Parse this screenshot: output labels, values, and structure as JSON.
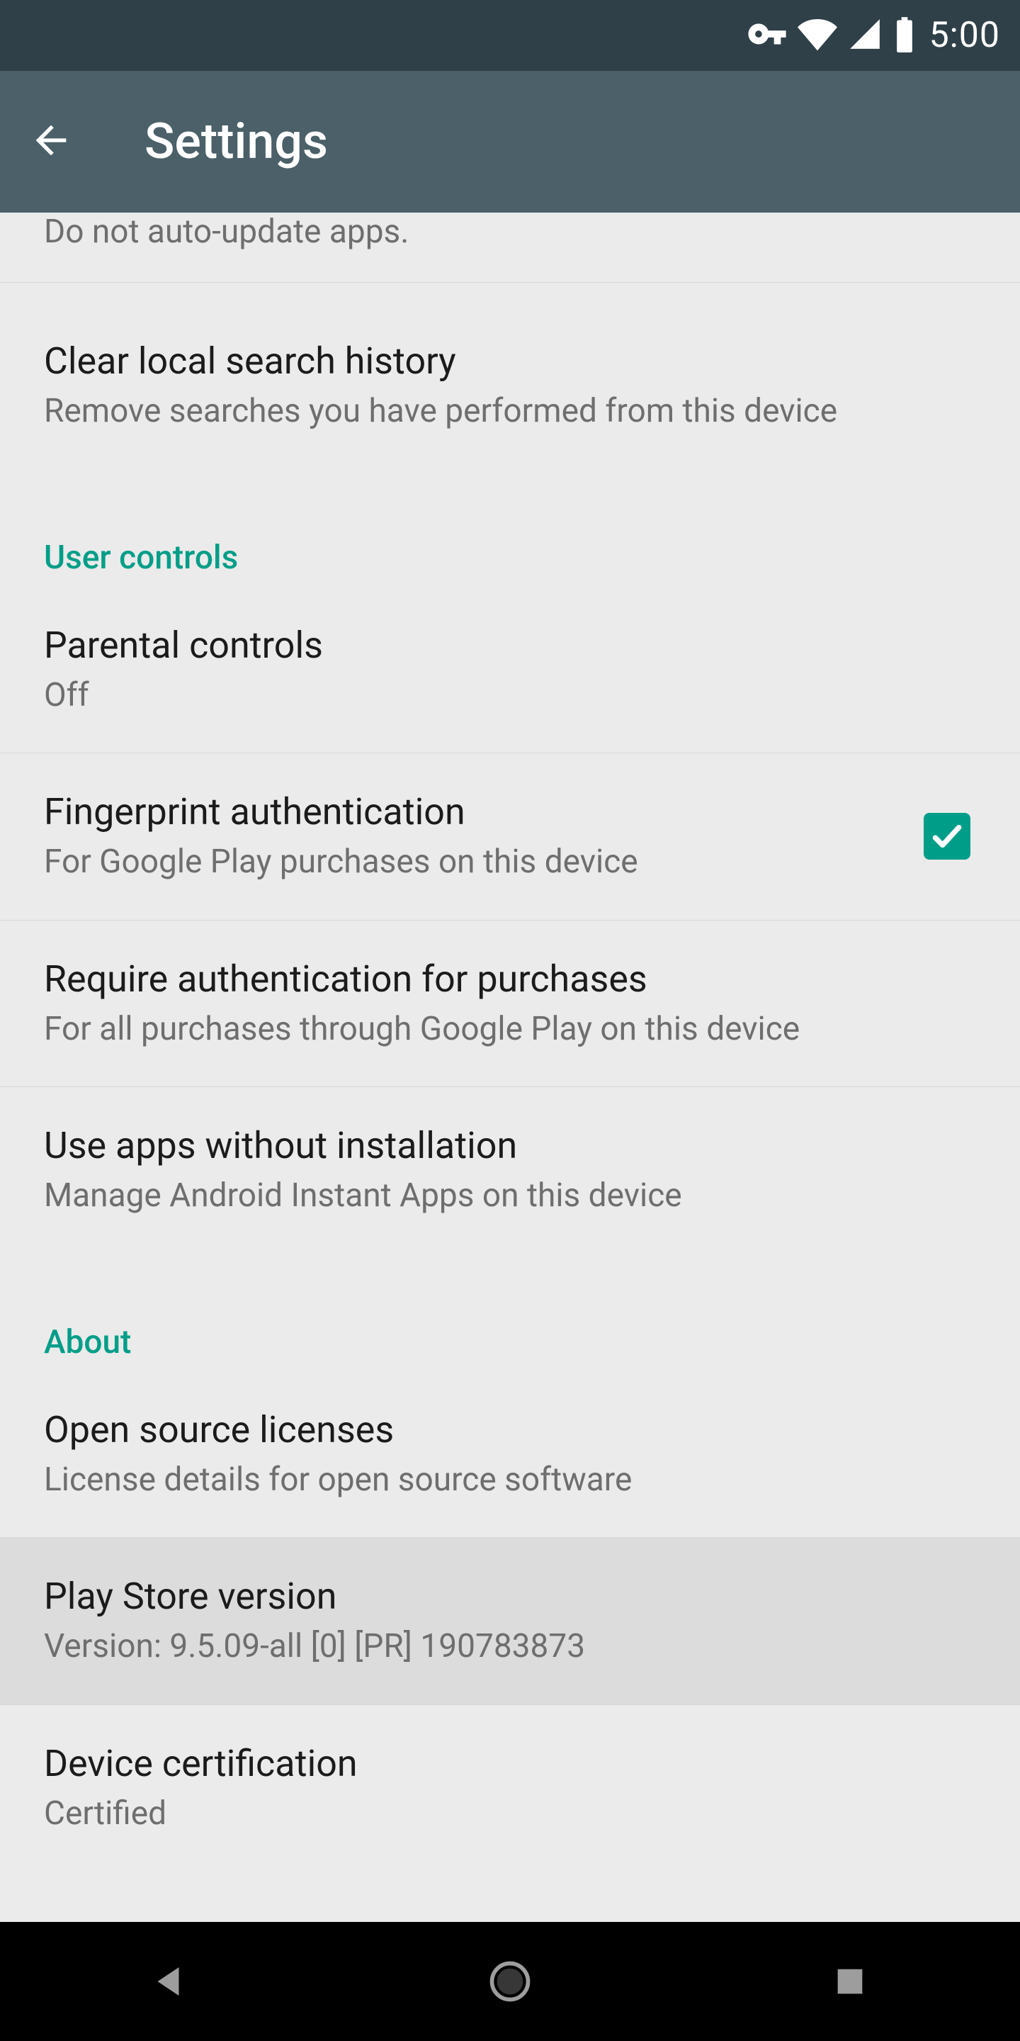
{
  "status": {
    "time": "5:00"
  },
  "header": {
    "title": "Settings"
  },
  "truncated": {
    "sub": "Do not auto-update apps."
  },
  "rows": {
    "clearSearch": {
      "title": "Clear local search history",
      "sub": "Remove searches you have performed from this device"
    },
    "parental": {
      "title": "Parental controls",
      "sub": "Off"
    },
    "fingerprint": {
      "title": "Fingerprint authentication",
      "sub": "For Google Play purchases on this device"
    },
    "requireAuth": {
      "title": "Require authentication for purchases",
      "sub": "For all purchases through Google Play on this device"
    },
    "instantApps": {
      "title": "Use apps without installation",
      "sub": "Manage Android Instant Apps on this device"
    },
    "licenses": {
      "title": "Open source licenses",
      "sub": "License details for open source software"
    },
    "version": {
      "title": "Play Store version",
      "sub": "Version: 9.5.09-all [0] [PR] 190783873"
    },
    "certification": {
      "title": "Device certification",
      "sub": "Certified"
    }
  },
  "sections": {
    "userControls": "User controls",
    "about": "About"
  }
}
